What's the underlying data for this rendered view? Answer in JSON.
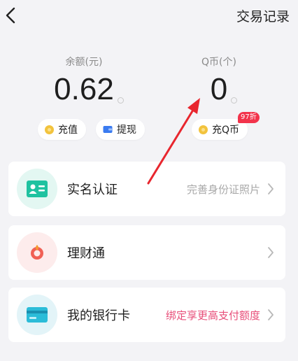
{
  "header": {
    "records_label": "交易记录"
  },
  "balance": {
    "label": "余额(元)",
    "value": "0.62"
  },
  "qcoin": {
    "label": "Q币(个)",
    "value": "0"
  },
  "actions": {
    "recharge_label": "充值",
    "withdraw_label": "提现",
    "recharge_qcoin_label": "充Q币",
    "discount_badge": "97折"
  },
  "cards": {
    "verify": {
      "title": "实名认证",
      "subtitle": "完善身份证照片"
    },
    "finance": {
      "title": "理财通",
      "subtitle": ""
    },
    "bank": {
      "title": "我的银行卡",
      "subtitle": "绑定享更高支付额度"
    }
  },
  "colors": {
    "accent_pink": "#e84f7a",
    "badge_red": "#f2334b",
    "annotation_red": "#e8262e",
    "coin_yellow": "#f2c33d"
  }
}
